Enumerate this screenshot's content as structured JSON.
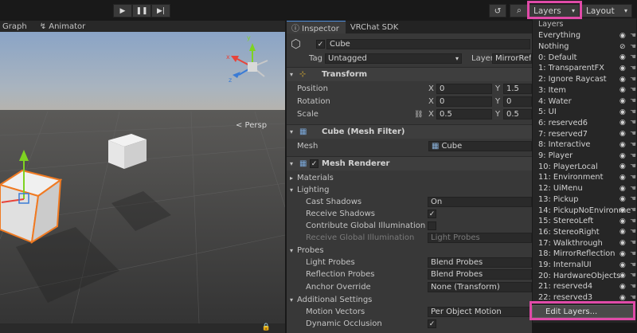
{
  "toolbar": {
    "play": "▶",
    "pause": "❚❚",
    "step": "▶|",
    "history": "↺",
    "search": "⌕",
    "layers_label": "Layers",
    "layout_label": "Layout",
    "caret": "▾"
  },
  "scene": {
    "tabs": [
      {
        "label": "Graph"
      },
      {
        "label": "↯ Animator"
      }
    ],
    "persp_label": "< Persp",
    "gizmo_x": "x",
    "gizmo_y": "y",
    "gizmo_z": "z",
    "lock": "🔒"
  },
  "inspector": {
    "tabs": [
      {
        "label": "ⓘ Inspector"
      },
      {
        "label": "VRChat SDK"
      }
    ],
    "object_name": "Cube",
    "tag_label": "Tag",
    "tag_value": "Untagged",
    "layer_label": "Layer",
    "layer_value": "MirrorRefle",
    "transform": {
      "title": "Transform",
      "rows": [
        {
          "label": "Position",
          "x": "0",
          "y": "1.5"
        },
        {
          "label": "Rotation",
          "x": "0",
          "y": "0"
        },
        {
          "label": "Scale",
          "x": "0.5",
          "y": "0.5"
        }
      ],
      "x_label": "X",
      "y_label": "Y"
    },
    "mesh_filter": {
      "title": "Cube (Mesh Filter)",
      "mesh_label": "Mesh",
      "mesh_value": "Cube"
    },
    "mesh_renderer": {
      "title": "Mesh Renderer",
      "materials": "Materials",
      "lighting": "Lighting",
      "cast_shadows_label": "Cast Shadows",
      "cast_shadows_value": "On",
      "receive_shadows_label": "Receive Shadows",
      "contribute_gi_label": "Contribute Global Illumination",
      "receive_gi_label": "Receive Global Illumination",
      "receive_gi_value": "Light Probes",
      "probes": "Probes",
      "light_probes_label": "Light Probes",
      "light_probes_value": "Blend Probes",
      "reflection_probes_label": "Reflection Probes",
      "reflection_probes_value": "Blend Probes",
      "anchor_label": "Anchor Override",
      "anchor_value": "None (Transform)",
      "additional": "Additional Settings",
      "motion_vectors_label": "Motion Vectors",
      "motion_vectors_value": "Per Object Motion",
      "dynamic_occlusion_label": "Dynamic Occlusion"
    }
  },
  "layers_menu": {
    "header": "Layers",
    "items": [
      "Everything",
      "Nothing",
      "0: Default",
      "1: TransparentFX",
      "2: Ignore Raycast",
      "3: Item",
      "4: Water",
      "5: UI",
      "6: reserved6",
      "7: reserved7",
      "8: Interactive",
      "9: Player",
      "10: PlayerLocal",
      "11: Environment",
      "12: UiMenu",
      "13: Pickup",
      "14: PickupNoEnvironme",
      "15: StereoLeft",
      "16: StereoRight",
      "17: Walkthrough",
      "18: MirrorReflection",
      "19: InternalUI",
      "20: HardwareObjects",
      "21: reserved4",
      "22: reserved3"
    ],
    "edit_label": "Edit Layers..."
  },
  "colors": {
    "highlight": "#e04aa8",
    "accent": "#4d8ee0",
    "gizmo_x": "#e8443a",
    "gizmo_y": "#7ed321",
    "gizmo_z": "#3a7bd5",
    "selection": "#f07a22"
  }
}
